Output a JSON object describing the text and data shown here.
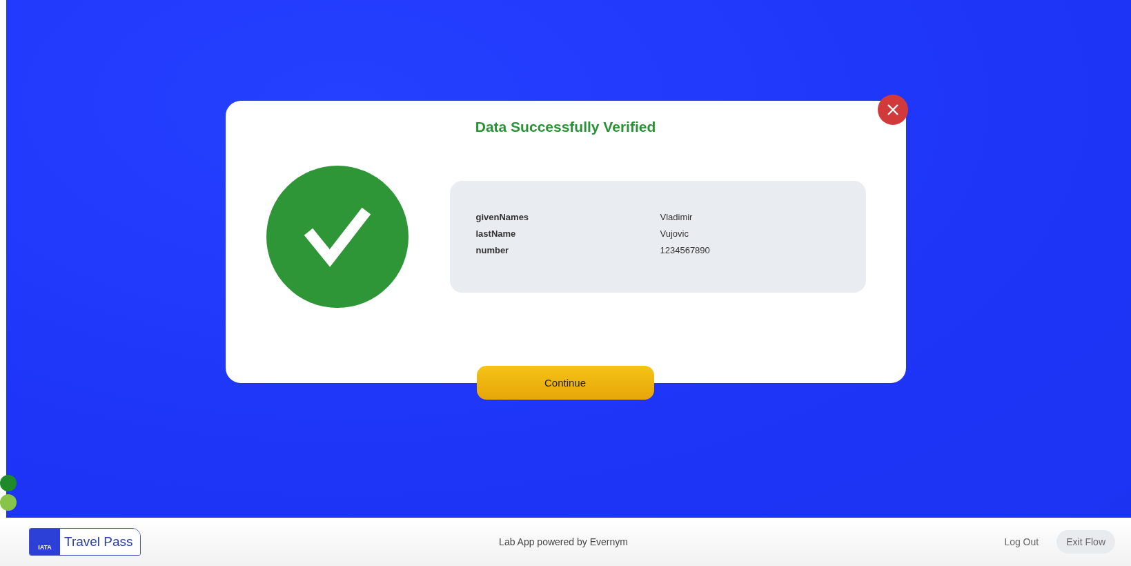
{
  "dialog": {
    "title": "Data Successfully Verified",
    "fields": [
      {
        "name": "givenNames",
        "value": "Vladimir"
      },
      {
        "name": "lastName",
        "value": "Vujovic"
      },
      {
        "name": "number",
        "value": "1234567890"
      }
    ],
    "continue_button": "Continue"
  },
  "footer": {
    "logo": {
      "badge": "IATA",
      "text": "Travel Pass"
    },
    "powered_by": "Lab App powered by Evernym",
    "links": [
      {
        "label": "Log Out",
        "kind": "link"
      },
      {
        "label": "Exit Flow",
        "kind": "pill"
      }
    ]
  }
}
